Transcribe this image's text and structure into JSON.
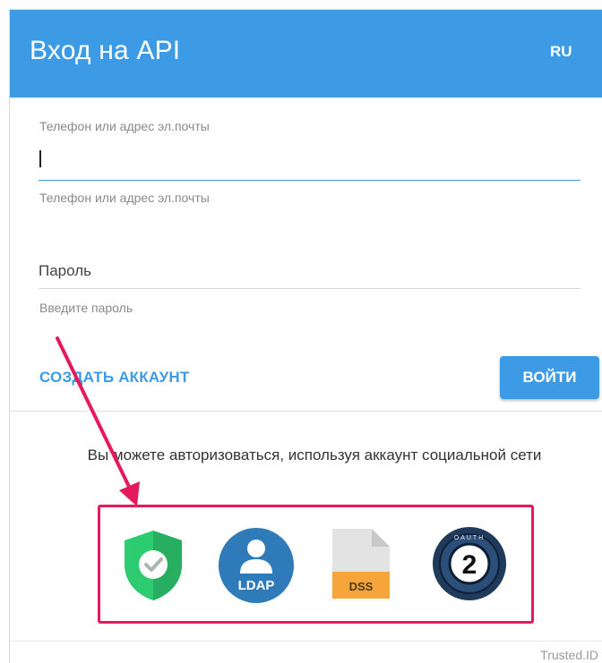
{
  "header": {
    "title": "Вход на API",
    "lang": "RU"
  },
  "login": {
    "label": "Телефон или адрес эл.почты",
    "value": "",
    "hint": "Телефон или адрес эл.почты"
  },
  "password": {
    "placeholder": "Пароль",
    "hint": "Введите пароль"
  },
  "actions": {
    "create_account": "СОЗДАТЬ АККАУНТ",
    "login": "ВОЙТИ"
  },
  "social": {
    "text": "Вы можете авторизоваться, используя аккаунт социальной сети",
    "providers": [
      {
        "icon": "shield-check-icon",
        "color": "#2ecc71"
      },
      {
        "icon": "ldap-icon",
        "label": "LDAP",
        "color": "#2f7ab8"
      },
      {
        "icon": "dss-icon",
        "label": "DSS",
        "color": "#f5a53a"
      },
      {
        "icon": "oauth2-icon",
        "label": "2",
        "ring": "OAUTH",
        "color": "#1f3a5a"
      }
    ]
  },
  "annotation": {
    "arrow_color": "#e6195f",
    "box_color": "#e6195f"
  },
  "footer": {
    "brand": "Trusted.ID"
  }
}
